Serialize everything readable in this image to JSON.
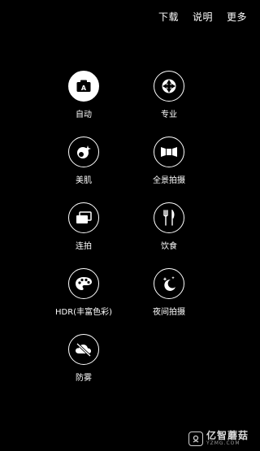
{
  "topbar": {
    "download_label": "下载",
    "help_label": "说明",
    "more_label": "更多"
  },
  "modes": [
    {
      "label": "自动",
      "icon": "auto-camera-icon",
      "selected": true
    },
    {
      "label": "专业",
      "icon": "aperture-icon",
      "selected": false
    },
    {
      "label": "美肌",
      "icon": "beauty-icon",
      "selected": false
    },
    {
      "label": "全景拍摄",
      "icon": "panorama-icon",
      "selected": false
    },
    {
      "label": "连拍",
      "icon": "burst-icon",
      "selected": false
    },
    {
      "label": "饮食",
      "icon": "fork-knife-icon",
      "selected": false
    },
    {
      "label": "HDR(丰富色彩)",
      "icon": "palette-icon",
      "selected": false
    },
    {
      "label": "夜间拍摄",
      "icon": "night-moon-icon",
      "selected": false
    },
    {
      "label": "防雾",
      "icon": "defog-icon",
      "selected": false
    }
  ],
  "watermark": {
    "title": "亿智蘑菇",
    "subtitle": "YZMG.COM",
    "icon": "watermark-logo-icon"
  }
}
